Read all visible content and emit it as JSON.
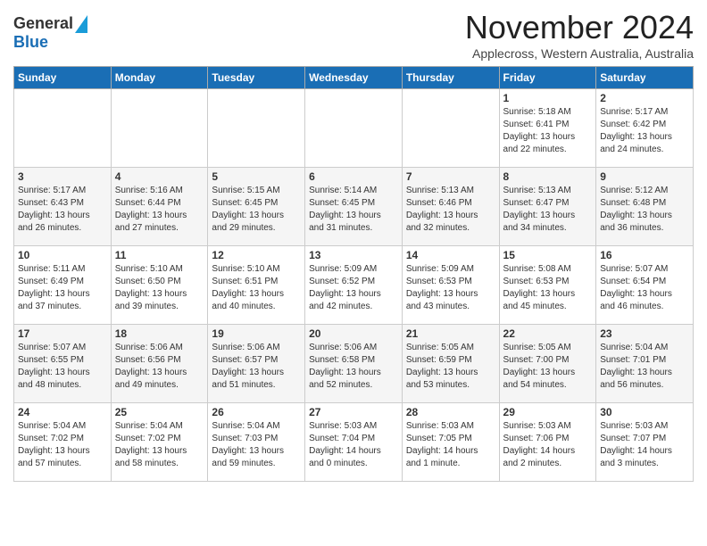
{
  "header": {
    "logo_general": "General",
    "logo_blue": "Blue",
    "month_title": "November 2024",
    "subtitle": "Applecross, Western Australia, Australia"
  },
  "days_of_week": [
    "Sunday",
    "Monday",
    "Tuesday",
    "Wednesday",
    "Thursday",
    "Friday",
    "Saturday"
  ],
  "weeks": [
    [
      {
        "day": "",
        "info": ""
      },
      {
        "day": "",
        "info": ""
      },
      {
        "day": "",
        "info": ""
      },
      {
        "day": "",
        "info": ""
      },
      {
        "day": "",
        "info": ""
      },
      {
        "day": "1",
        "info": "Sunrise: 5:18 AM\nSunset: 6:41 PM\nDaylight: 13 hours\nand 22 minutes."
      },
      {
        "day": "2",
        "info": "Sunrise: 5:17 AM\nSunset: 6:42 PM\nDaylight: 13 hours\nand 24 minutes."
      }
    ],
    [
      {
        "day": "3",
        "info": "Sunrise: 5:17 AM\nSunset: 6:43 PM\nDaylight: 13 hours\nand 26 minutes."
      },
      {
        "day": "4",
        "info": "Sunrise: 5:16 AM\nSunset: 6:44 PM\nDaylight: 13 hours\nand 27 minutes."
      },
      {
        "day": "5",
        "info": "Sunrise: 5:15 AM\nSunset: 6:45 PM\nDaylight: 13 hours\nand 29 minutes."
      },
      {
        "day": "6",
        "info": "Sunrise: 5:14 AM\nSunset: 6:45 PM\nDaylight: 13 hours\nand 31 minutes."
      },
      {
        "day": "7",
        "info": "Sunrise: 5:13 AM\nSunset: 6:46 PM\nDaylight: 13 hours\nand 32 minutes."
      },
      {
        "day": "8",
        "info": "Sunrise: 5:13 AM\nSunset: 6:47 PM\nDaylight: 13 hours\nand 34 minutes."
      },
      {
        "day": "9",
        "info": "Sunrise: 5:12 AM\nSunset: 6:48 PM\nDaylight: 13 hours\nand 36 minutes."
      }
    ],
    [
      {
        "day": "10",
        "info": "Sunrise: 5:11 AM\nSunset: 6:49 PM\nDaylight: 13 hours\nand 37 minutes."
      },
      {
        "day": "11",
        "info": "Sunrise: 5:10 AM\nSunset: 6:50 PM\nDaylight: 13 hours\nand 39 minutes."
      },
      {
        "day": "12",
        "info": "Sunrise: 5:10 AM\nSunset: 6:51 PM\nDaylight: 13 hours\nand 40 minutes."
      },
      {
        "day": "13",
        "info": "Sunrise: 5:09 AM\nSunset: 6:52 PM\nDaylight: 13 hours\nand 42 minutes."
      },
      {
        "day": "14",
        "info": "Sunrise: 5:09 AM\nSunset: 6:53 PM\nDaylight: 13 hours\nand 43 minutes."
      },
      {
        "day": "15",
        "info": "Sunrise: 5:08 AM\nSunset: 6:53 PM\nDaylight: 13 hours\nand 45 minutes."
      },
      {
        "day": "16",
        "info": "Sunrise: 5:07 AM\nSunset: 6:54 PM\nDaylight: 13 hours\nand 46 minutes."
      }
    ],
    [
      {
        "day": "17",
        "info": "Sunrise: 5:07 AM\nSunset: 6:55 PM\nDaylight: 13 hours\nand 48 minutes."
      },
      {
        "day": "18",
        "info": "Sunrise: 5:06 AM\nSunset: 6:56 PM\nDaylight: 13 hours\nand 49 minutes."
      },
      {
        "day": "19",
        "info": "Sunrise: 5:06 AM\nSunset: 6:57 PM\nDaylight: 13 hours\nand 51 minutes."
      },
      {
        "day": "20",
        "info": "Sunrise: 5:06 AM\nSunset: 6:58 PM\nDaylight: 13 hours\nand 52 minutes."
      },
      {
        "day": "21",
        "info": "Sunrise: 5:05 AM\nSunset: 6:59 PM\nDaylight: 13 hours\nand 53 minutes."
      },
      {
        "day": "22",
        "info": "Sunrise: 5:05 AM\nSunset: 7:00 PM\nDaylight: 13 hours\nand 54 minutes."
      },
      {
        "day": "23",
        "info": "Sunrise: 5:04 AM\nSunset: 7:01 PM\nDaylight: 13 hours\nand 56 minutes."
      }
    ],
    [
      {
        "day": "24",
        "info": "Sunrise: 5:04 AM\nSunset: 7:02 PM\nDaylight: 13 hours\nand 57 minutes."
      },
      {
        "day": "25",
        "info": "Sunrise: 5:04 AM\nSunset: 7:02 PM\nDaylight: 13 hours\nand 58 minutes."
      },
      {
        "day": "26",
        "info": "Sunrise: 5:04 AM\nSunset: 7:03 PM\nDaylight: 13 hours\nand 59 minutes."
      },
      {
        "day": "27",
        "info": "Sunrise: 5:03 AM\nSunset: 7:04 PM\nDaylight: 14 hours\nand 0 minutes."
      },
      {
        "day": "28",
        "info": "Sunrise: 5:03 AM\nSunset: 7:05 PM\nDaylight: 14 hours\nand 1 minute."
      },
      {
        "day": "29",
        "info": "Sunrise: 5:03 AM\nSunset: 7:06 PM\nDaylight: 14 hours\nand 2 minutes."
      },
      {
        "day": "30",
        "info": "Sunrise: 5:03 AM\nSunset: 7:07 PM\nDaylight: 14 hours\nand 3 minutes."
      }
    ]
  ]
}
